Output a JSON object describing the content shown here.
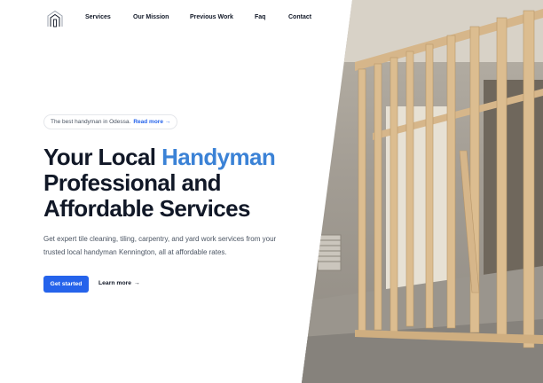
{
  "nav": {
    "items": [
      {
        "label": "Services"
      },
      {
        "label": "Our Mission"
      },
      {
        "label": "Previous Work"
      },
      {
        "label": "Faq"
      },
      {
        "label": "Contact"
      }
    ]
  },
  "announcement": {
    "text": "The best handyman in Odessa.",
    "link_label": "Read more",
    "link_arrow": "→"
  },
  "hero": {
    "title_part1": "Your Local ",
    "title_accent": "Handyman",
    "title_part2": "Professional and Affordable Services",
    "description": "Get expert tile cleaning, tiling, carpentry, and yard work services from your trusted local handyman Kennington, all at affordable rates.",
    "primary_cta": "Get started",
    "secondary_cta": "Learn more",
    "secondary_arrow": "→"
  },
  "colors": {
    "accent": "#3b82d6",
    "primary_button": "#2563eb",
    "heading": "#111827"
  },
  "icons": {
    "logo": "house-logo-icon"
  }
}
